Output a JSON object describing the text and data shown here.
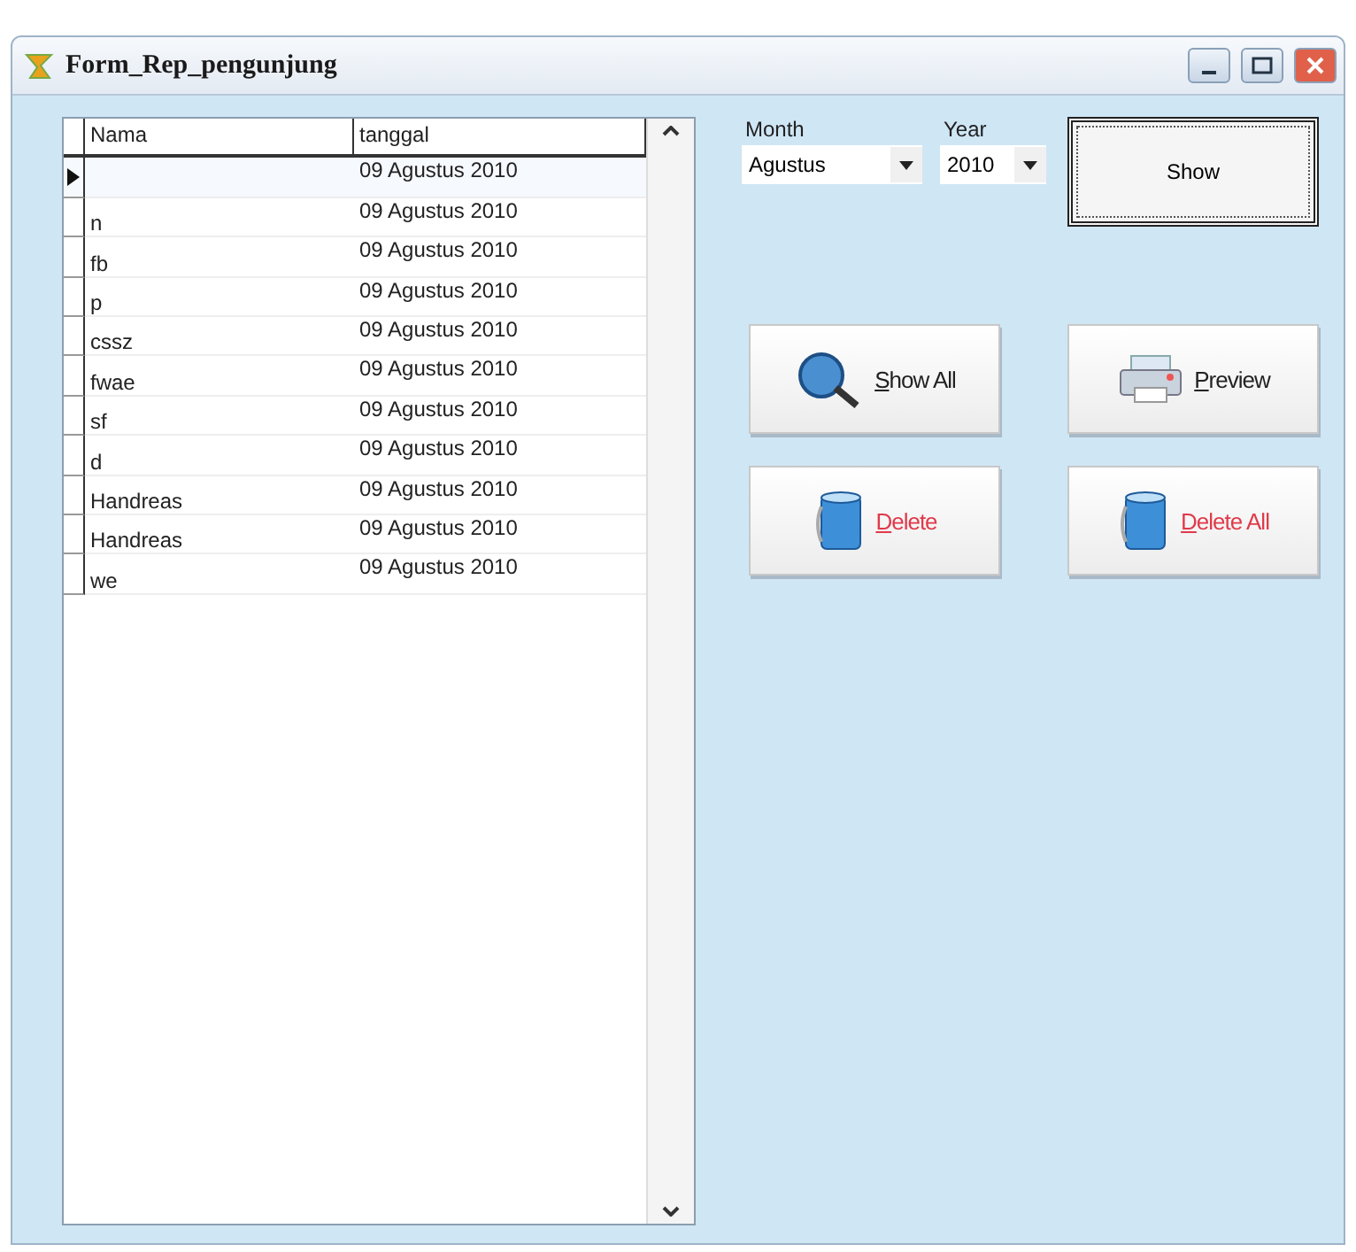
{
  "window": {
    "title": "Form_Rep_pengunjung"
  },
  "table": {
    "columns": [
      "Nama",
      "tanggal"
    ],
    "rows": [
      {
        "nama": "",
        "tanggal": "09 Agustus 2010",
        "selected": true
      },
      {
        "nama": "n",
        "tanggal": "09 Agustus 2010",
        "selected": false
      },
      {
        "nama": "fb",
        "tanggal": "09 Agustus 2010",
        "selected": false
      },
      {
        "nama": "p",
        "tanggal": "09 Agustus 2010",
        "selected": false
      },
      {
        "nama": "cssz",
        "tanggal": "09 Agustus 2010",
        "selected": false
      },
      {
        "nama": "fwae",
        "tanggal": "09 Agustus 2010",
        "selected": false
      },
      {
        "nama": "sf",
        "tanggal": "09 Agustus 2010",
        "selected": false
      },
      {
        "nama": "d",
        "tanggal": "09 Agustus 2010",
        "selected": false
      },
      {
        "nama": "Handreas",
        "tanggal": "09 Agustus 2010",
        "selected": false
      },
      {
        "nama": "Handreas",
        "tanggal": "09 Agustus 2010",
        "selected": false
      },
      {
        "nama": "we",
        "tanggal": "09 Agustus 2010",
        "selected": false
      }
    ]
  },
  "filters": [
    {
      "label": "Month",
      "value": "Agustus"
    },
    {
      "label": "Year",
      "value": "2010"
    }
  ],
  "show_button": {
    "label": "Show"
  },
  "actions": [
    {
      "label": "Show All",
      "kind": "search"
    },
    {
      "label": "Preview",
      "kind": "print"
    },
    {
      "label": "Delete",
      "kind": "delete"
    },
    {
      "label": "Delete All",
      "kind": "delete"
    }
  ]
}
